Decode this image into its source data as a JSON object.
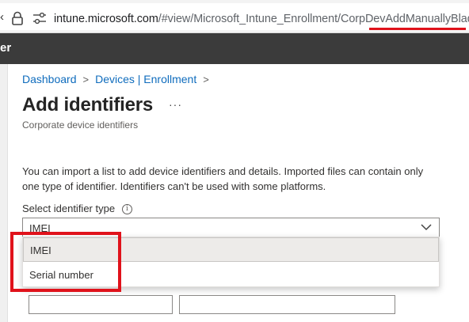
{
  "browser": {
    "url_host": "intune.microsoft.com",
    "url_path": "/#view/Microsoft_Intune_Enrollment/CorpDevAddManuallyBlade",
    "nav_edge": "‹",
    "icons": [
      "lock-icon",
      "site-settings-icon"
    ],
    "highlight_color": "#e0121b"
  },
  "portal": {
    "title_fragment": "er"
  },
  "breadcrumb": {
    "items": [
      "Dashboard",
      "Devices | Enrollment"
    ]
  },
  "page": {
    "title": "Add identifiers",
    "more_label": "···",
    "subtitle": "Corporate device identifiers",
    "description": "You can import a list to add device identifiers and details. Imported files can contain only one type of identifier. Identifiers can't be used with some platforms."
  },
  "identifier_type": {
    "label": "Select identifier type",
    "info_glyph": "i",
    "selected_value": "IMEI",
    "options": [
      "IMEI",
      "Serial number"
    ]
  },
  "colors": {
    "link": "#0f6cbd",
    "header_bg": "#3b3b3b",
    "annotation_red": "#e0121b"
  }
}
